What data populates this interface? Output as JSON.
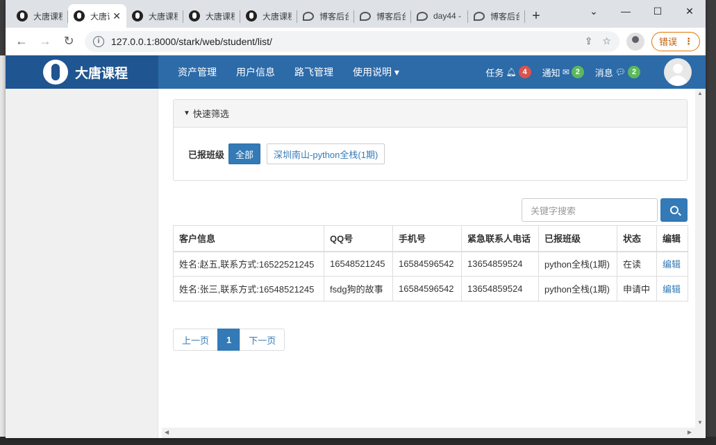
{
  "browser": {
    "tabs": [
      {
        "label": "大唐课程",
        "icon": "person-icon"
      },
      {
        "label": "大唐课程",
        "icon": "person-icon",
        "active": true
      },
      {
        "label": "大唐课程",
        "icon": "person-icon"
      },
      {
        "label": "大唐课程",
        "icon": "person-icon"
      },
      {
        "label": "大唐课程",
        "icon": "person-icon"
      },
      {
        "label": "博客后台",
        "icon": "swirl-icon"
      },
      {
        "label": "博客后台",
        "icon": "swirl-icon"
      },
      {
        "label": "day44 -",
        "icon": "swirl-icon"
      },
      {
        "label": "博客后台",
        "icon": "swirl-icon"
      }
    ],
    "url": "127.0.0.1:8000/stark/web/student/list/",
    "error_button": "错误"
  },
  "navbar": {
    "brand": "大唐课程",
    "menu": [
      "资产管理",
      "用户信息",
      "路飞管理",
      "使用说明"
    ],
    "tasks": {
      "label": "任务",
      "count": "4"
    },
    "notices": {
      "label": "通知",
      "count": "2"
    },
    "messages": {
      "label": "消息",
      "count": "2"
    }
  },
  "filter": {
    "title": "快速筛选",
    "label": "已报班级",
    "options": [
      "全部",
      "深圳南山-python全栈(1期)"
    ],
    "selected": "全部"
  },
  "search": {
    "placeholder": "关键字搜索"
  },
  "table": {
    "headers": [
      "客户信息",
      "QQ号",
      "手机号",
      "紧急联系人电话",
      "已报班级",
      "状态",
      "编辑"
    ],
    "rows": [
      [
        "姓名:赵五,联系方式:16522521245",
        "16548521245",
        "16584596542",
        "13654859524",
        "python全栈(1期)",
        "在读",
        "编辑"
      ],
      [
        "姓名:张三,联系方式:16548521245",
        "fsdg狗的故事",
        "16584596542",
        "13654859524",
        "python全栈(1期)",
        "申请中",
        "编辑"
      ]
    ]
  },
  "pagination": {
    "prev": "上一页",
    "current": "1",
    "next": "下一页"
  },
  "colors": {
    "navbar": "#2c6ba8",
    "brand": "#1f5590",
    "primary": "#337ab7",
    "badge_red": "#d9534f",
    "badge_green": "#5cb85c"
  }
}
